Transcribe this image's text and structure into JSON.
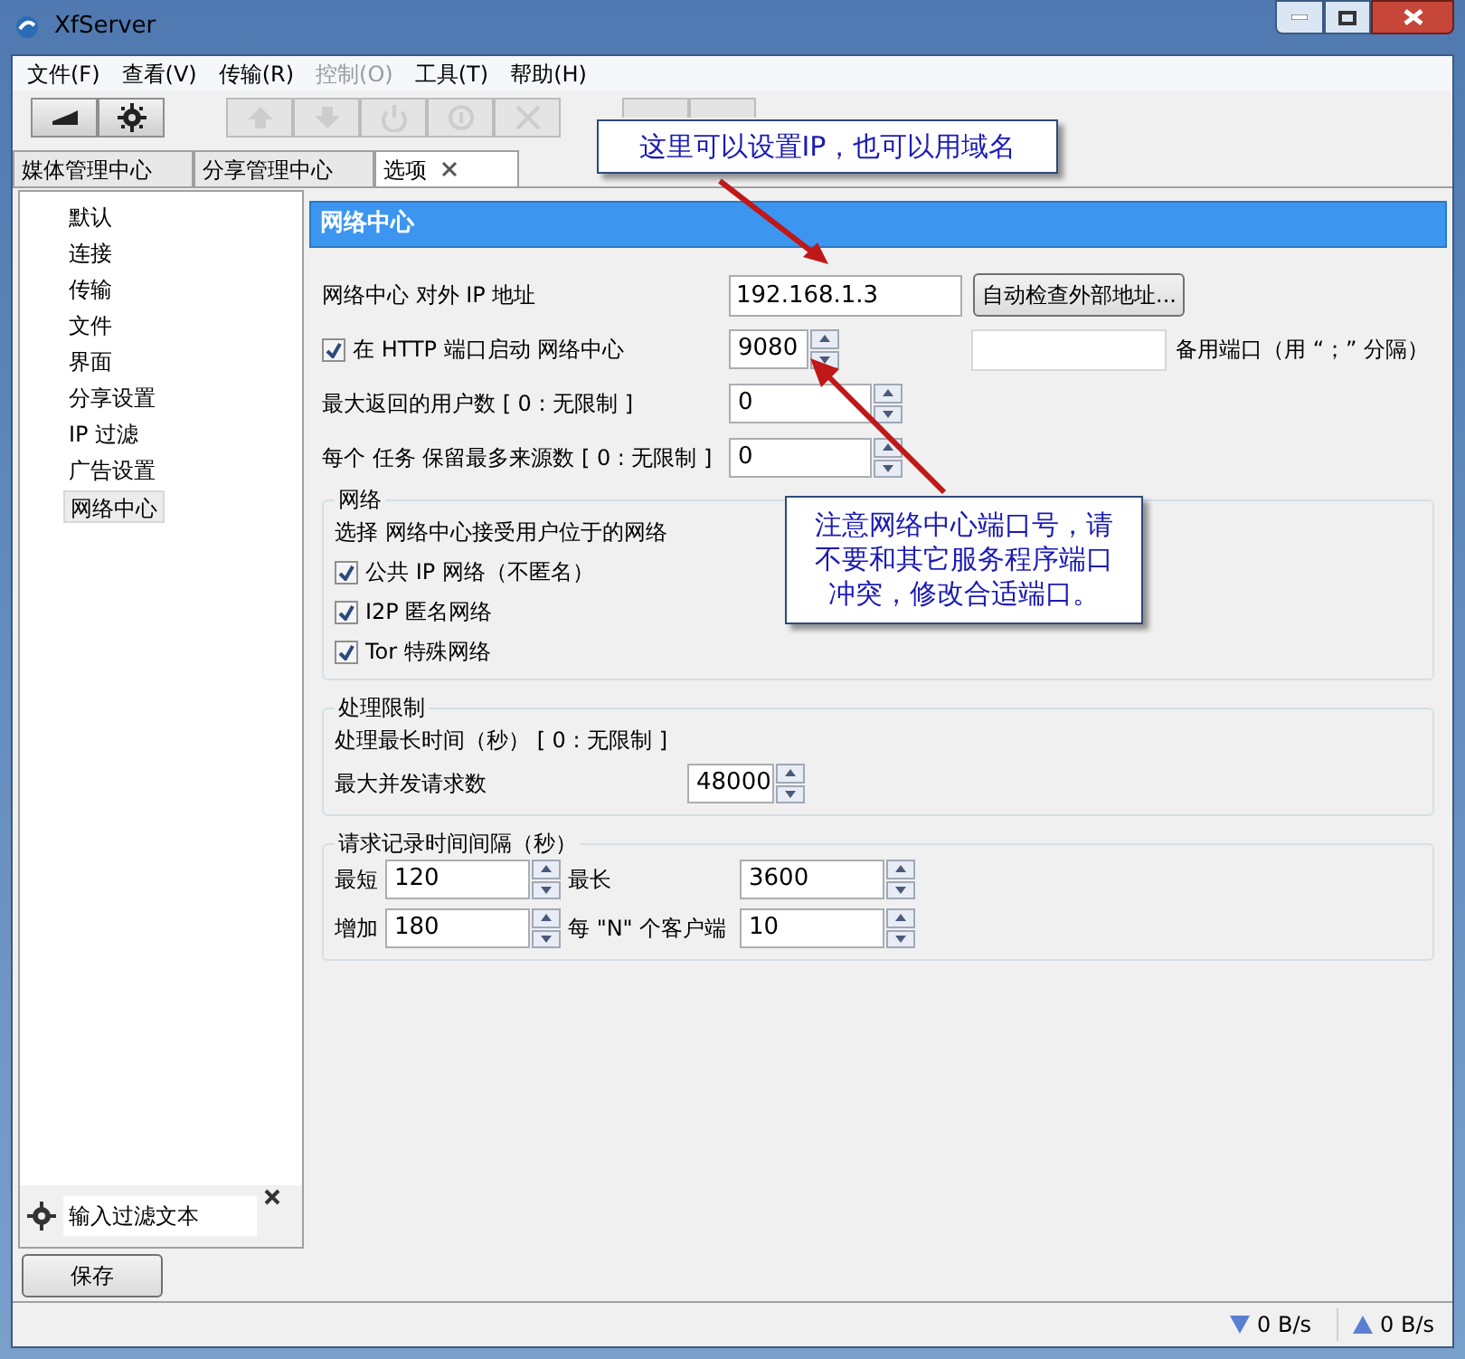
{
  "window": {
    "title": "XfServer"
  },
  "menu": [
    {
      "label": "文件(F)",
      "disabled": false
    },
    {
      "label": "查看(V)",
      "disabled": false
    },
    {
      "label": "传输(R)",
      "disabled": false
    },
    {
      "label": "控制(O)",
      "disabled": true
    },
    {
      "label": "工具(T)",
      "disabled": false
    },
    {
      "label": "帮助(H)",
      "disabled": false
    }
  ],
  "toolbar": [
    {
      "buttons": [
        {
          "disabled": false
        },
        {
          "disabled": false
        }
      ]
    },
    {
      "buttons": [
        {
          "disabled": true
        },
        {
          "disabled": true
        },
        {
          "disabled": true
        },
        {
          "disabled": true
        },
        {
          "disabled": true
        }
      ]
    },
    {
      "buttons": [
        {
          "disabled": true
        },
        {
          "disabled": true
        }
      ]
    }
  ],
  "tabs": [
    {
      "label": "媒体管理中心",
      "selected": false,
      "closable": false
    },
    {
      "label": "分享管理中心",
      "selected": false,
      "closable": false
    },
    {
      "label": "选项",
      "selected": true,
      "closable": true
    }
  ],
  "sidebar": {
    "items": [
      {
        "label": "默认",
        "selected": false
      },
      {
        "label": "连接",
        "selected": false
      },
      {
        "label": "传输",
        "selected": false
      },
      {
        "label": "文件",
        "selected": false
      },
      {
        "label": "界面",
        "selected": false
      },
      {
        "label": "分享设置",
        "selected": false
      },
      {
        "label": "IP 过滤",
        "selected": false
      },
      {
        "label": "广告设置",
        "selected": false
      },
      {
        "label": "网络中心",
        "selected": true
      }
    ],
    "filter": {
      "placeholder": "输入过滤文本"
    }
  },
  "panel": {
    "title": "网络中心",
    "ip": {
      "label": "网络中心 对外 IP 地址",
      "value": "192.168.1.3",
      "button": "自动检查外部地址..."
    },
    "http": {
      "label": "在 HTTP 端口启动 网络中心",
      "checked": true,
      "port": "9080",
      "alt_port_label": "备用端口（用 “；” 分隔）"
    },
    "max_users": {
      "label": "最大返回的用户数 [ 0 : 无限制 ]",
      "value": "0"
    },
    "max_sources": {
      "label": "每个 任务 保留最多来源数 [ 0 : 无限制 ]",
      "value": "0"
    },
    "network_group": {
      "title": "网络",
      "description": "选择 网络中心接受用户位于的网络",
      "options": [
        {
          "label": "公共 IP 网络（不匿名）",
          "checked": true
        },
        {
          "label": "I2P 匿名网络",
          "checked": true
        },
        {
          "label": "Tor 特殊网络",
          "checked": true
        }
      ]
    },
    "limits_group": {
      "title": "处理限制",
      "max_time_label": "处理最长时间（秒） [ 0 : 无限制 ]",
      "max_requests": {
        "label": "最大并发请求数",
        "value": "48000"
      }
    },
    "interval_group": {
      "title": "请求记录时间间隔（秒）",
      "rows": [
        [
          {
            "label": "最短",
            "value": "120"
          },
          {
            "label": "最长",
            "value": "3600"
          }
        ],
        [
          {
            "label": "增加",
            "value": "180"
          },
          {
            "label": "每 \"N\" 个客户端",
            "value": "10"
          }
        ]
      ]
    }
  },
  "save_button": "保存",
  "status_bar": {
    "download": "0 B/s",
    "upload": "0 B/s"
  },
  "callouts": [
    {
      "text": "这里可以设置IP，也可以用域名"
    },
    {
      "text": "注意网络中心端口号，请不要和其它服务程序端口冲突，修改合适端口。"
    }
  ]
}
